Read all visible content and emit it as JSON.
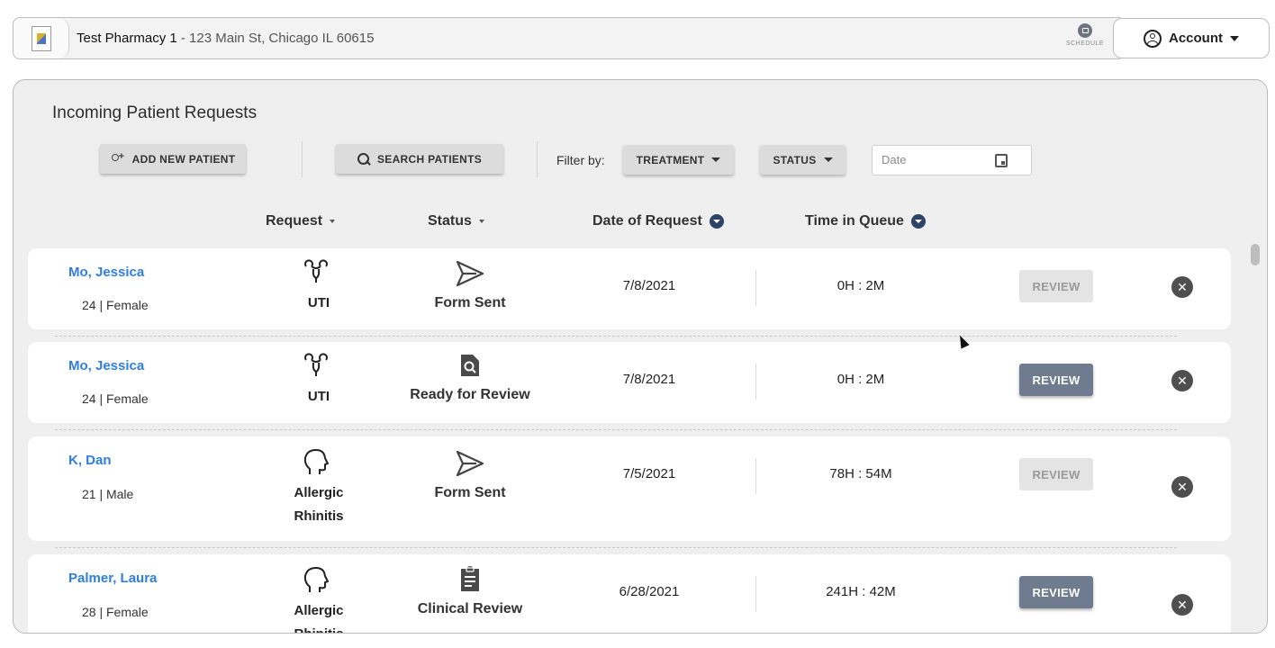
{
  "header": {
    "pharmacy_name": "Test Pharmacy 1",
    "pharmacy_address": " - 123 Main St, Chicago IL 60615",
    "schedule_label": "SCHEDULE",
    "account_label": "Account"
  },
  "panel": {
    "title": "Incoming Patient Requests",
    "add_patient_label": "ADD NEW PATIENT",
    "search_patients_label": "SEARCH PATIENTS",
    "filter_label": "Filter by:",
    "treatment_filter_label": "TREATMENT",
    "status_filter_label": "STATUS",
    "date_placeholder": "Date"
  },
  "columns": {
    "request": "Request",
    "status": "Status",
    "date_of_request": "Date of Request",
    "time_in_queue": "Time in Queue"
  },
  "rows": [
    {
      "name": "Mo, Jessica",
      "info": "24 | Female",
      "request": "UTI",
      "status": "Form Sent",
      "date": "7/8/2021",
      "queue": "0H : 2M",
      "review": "REVIEW"
    },
    {
      "name": "Mo, Jessica",
      "info": "24 | Female",
      "request": "UTI",
      "status": "Ready for Review",
      "date": "7/8/2021",
      "queue": "0H : 2M",
      "review": "REVIEW"
    },
    {
      "name": "K, Dan",
      "info": "21 | Male",
      "request_line1": "Allergic",
      "request_line2": "Rhinitis",
      "status": "Form Sent",
      "date": "7/5/2021",
      "queue": "78H : 54M",
      "review": "REVIEW"
    },
    {
      "name": "Palmer, Laura",
      "info": "28 | Female",
      "request_line1": "Allergic",
      "request_line2": "Rhinitis",
      "status": "Clinical Review",
      "date": "6/28/2021",
      "queue": "241H : 42M",
      "review": "REVIEW"
    }
  ],
  "icons": {
    "uti": "bladder-icon",
    "allergic": "head-profile-icon",
    "form_sent": "send-icon",
    "ready_for_review": "document-search-icon",
    "clinical_review": "clipboard-icon"
  },
  "colors": {
    "link": "#2e7ee6",
    "review_active": "#6f7b8f",
    "review_disabled": "#e4e4e4",
    "sort_indicator": "#2d4466"
  }
}
